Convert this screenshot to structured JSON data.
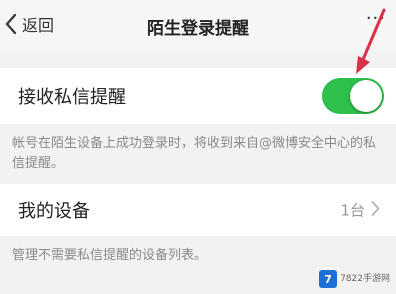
{
  "navbar": {
    "back_label": "返回",
    "title": "陌生登录提醒",
    "more_label": "···"
  },
  "setting_private_msg": {
    "label": "接收私信提醒",
    "enabled": true,
    "toggle_color": "#2fbf4b",
    "description": "帐号在陌生设备上成功登录时，将收到来自@微博安全中心的私信提醒。"
  },
  "setting_devices": {
    "label": "我的设备",
    "value": "1台",
    "description": "管理不需要私信提醒的设备列表。"
  },
  "annotation": {
    "arrow_color": "#d9304a"
  },
  "watermark": {
    "logo_text": "7",
    "text": "7822手游网"
  },
  "icons": {
    "back": "chevron-left-icon",
    "more": "more-dots-icon",
    "row_arrow": "chevron-right-icon"
  }
}
